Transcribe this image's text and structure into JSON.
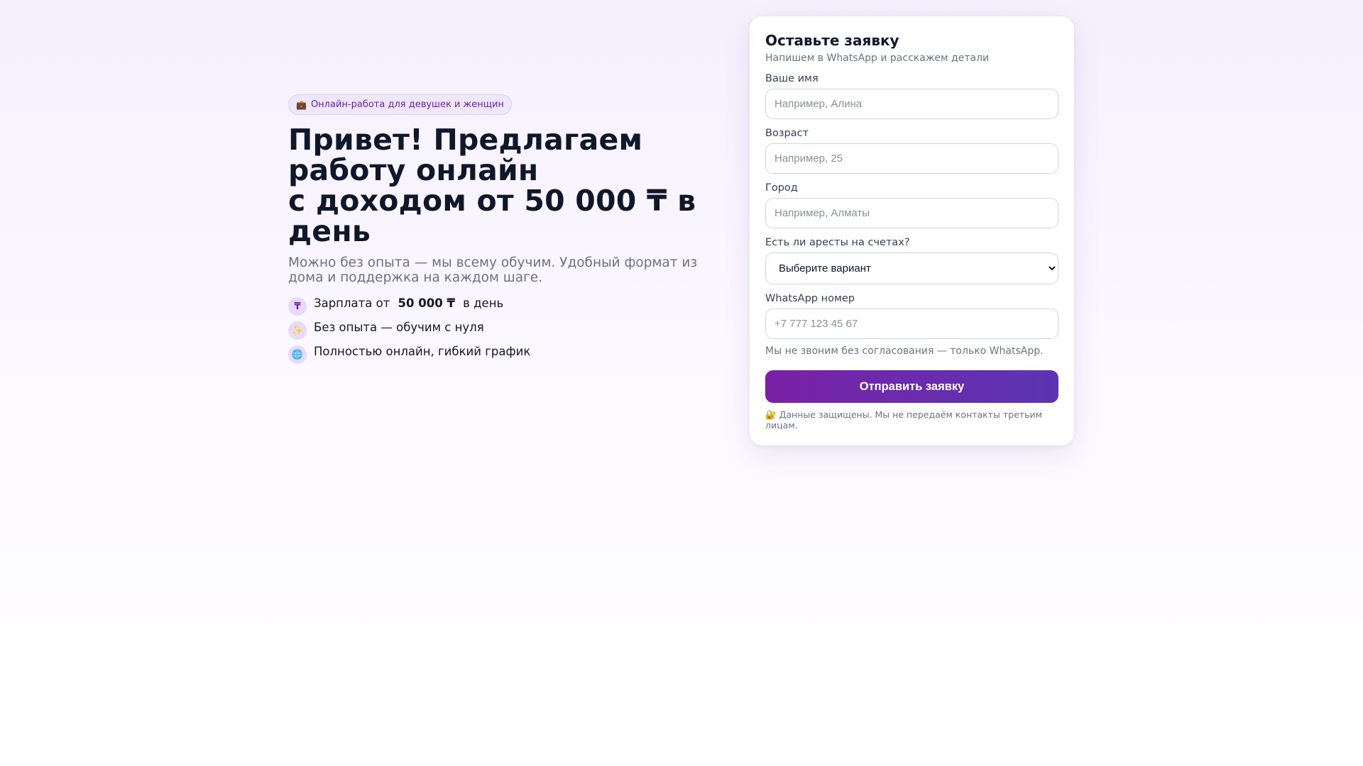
{
  "hero": {
    "badge_icon": "💼",
    "badge_text": "Онлайн-работа для девушек и женщин",
    "title_lines": [
      "Привет! Предлагаем",
      "работу онлайн",
      "с доходом от 50 000 ₸ в",
      "день"
    ],
    "subtitle": "Можно без опыта — мы всему обучим. Удобный формат из дома и поддержка на каждом шаге.",
    "features": [
      {
        "icon": "₸",
        "icon_name": "tenge-icon",
        "before": "Зарплата от",
        "bold": "50 000 ₸",
        "after": "в день"
      },
      {
        "icon": "✨",
        "icon_name": "sparkles-icon",
        "text": "Без опыта — обучим с нуля"
      },
      {
        "icon": "🌐",
        "icon_name": "globe-icon",
        "text": "Полностью онлайн, гибкий график"
      }
    ]
  },
  "form": {
    "title": "Оставьте заявку",
    "subtitle": "Напишем в WhatsApp и расскажем детали",
    "name": {
      "label": "Ваше имя",
      "placeholder": "Например, Алина"
    },
    "age": {
      "label": "Возраст",
      "placeholder": "Например, 25"
    },
    "city": {
      "label": "Город",
      "placeholder": "Например, Алматы"
    },
    "arrests": {
      "label": "Есть ли аресты на счетах?",
      "selected": "Выберите вариант"
    },
    "whatsapp": {
      "label": "WhatsApp номер",
      "placeholder": "+7 777 123 45 67",
      "hint": "Мы не звоним без согласования — только WhatsApp."
    },
    "submit_label": "Отправить заявку",
    "privacy_icon": "🔐",
    "privacy_text": "Данные защищены. Мы не передаём контакты третьим лицам."
  },
  "colors": {
    "accent": "#7a21a6",
    "accent_end": "#5b35b3",
    "badge_bg": "#efe7fd",
    "text_dark": "#0f172a",
    "text_muted": "#6b7280"
  }
}
